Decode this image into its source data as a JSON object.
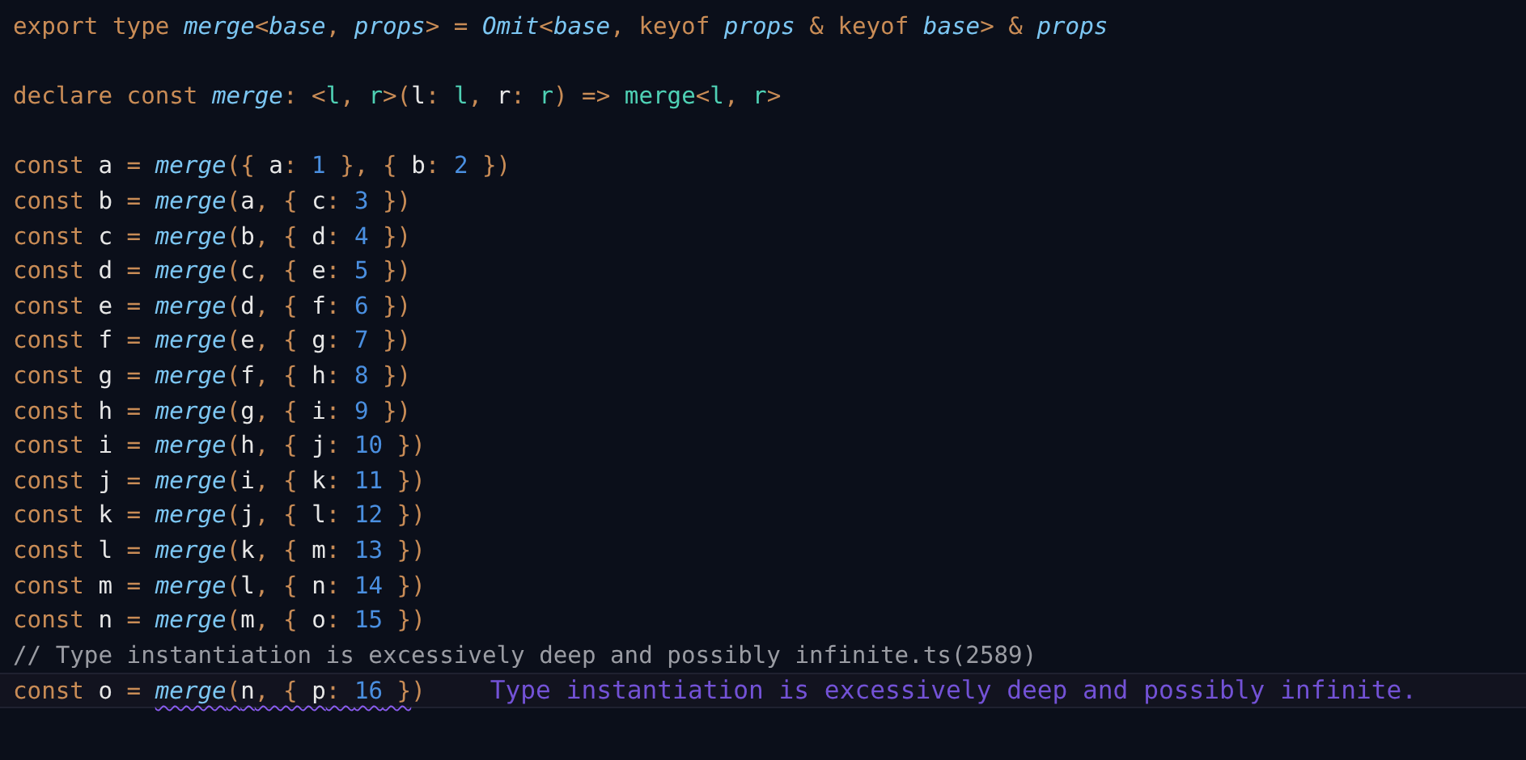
{
  "editor": {
    "lines": [
      {
        "kind": "code",
        "tokens": [
          {
            "text": "export type ",
            "kind": "keyword"
          },
          {
            "text": "merge",
            "kind": "type"
          },
          {
            "text": "<",
            "kind": "punct"
          },
          {
            "text": "base",
            "kind": "type"
          },
          {
            "text": ", ",
            "kind": "punct"
          },
          {
            "text": "props",
            "kind": "type"
          },
          {
            "text": "> = ",
            "kind": "punct"
          },
          {
            "text": "Omit",
            "kind": "type"
          },
          {
            "text": "<",
            "kind": "punct"
          },
          {
            "text": "base",
            "kind": "type"
          },
          {
            "text": ", ",
            "kind": "punct"
          },
          {
            "text": "keyof ",
            "kind": "keyword"
          },
          {
            "text": "props",
            "kind": "type"
          },
          {
            "text": " & ",
            "kind": "punct"
          },
          {
            "text": "keyof ",
            "kind": "keyword"
          },
          {
            "text": "base",
            "kind": "type"
          },
          {
            "text": "> & ",
            "kind": "punct"
          },
          {
            "text": "props",
            "kind": "type"
          }
        ]
      },
      {
        "kind": "blank"
      },
      {
        "kind": "code",
        "tokens": [
          {
            "text": "declare const ",
            "kind": "keyword"
          },
          {
            "text": "merge",
            "kind": "type"
          },
          {
            "text": ": <",
            "kind": "punct"
          },
          {
            "text": "l",
            "kind": "param"
          },
          {
            "text": ", ",
            "kind": "punct"
          },
          {
            "text": "r",
            "kind": "param"
          },
          {
            "text": ">(",
            "kind": "punct"
          },
          {
            "text": "l",
            "kind": "var"
          },
          {
            "text": ": ",
            "kind": "punct"
          },
          {
            "text": "l",
            "kind": "param"
          },
          {
            "text": ", ",
            "kind": "punct"
          },
          {
            "text": "r",
            "kind": "var"
          },
          {
            "text": ": ",
            "kind": "punct"
          },
          {
            "text": "r",
            "kind": "param"
          },
          {
            "text": ") => ",
            "kind": "punct"
          },
          {
            "text": "merge",
            "kind": "param"
          },
          {
            "text": "<",
            "kind": "punct"
          },
          {
            "text": "l",
            "kind": "param"
          },
          {
            "text": ", ",
            "kind": "punct"
          },
          {
            "text": "r",
            "kind": "param"
          },
          {
            "text": ">",
            "kind": "punct"
          }
        ]
      },
      {
        "kind": "blank"
      },
      {
        "kind": "code",
        "tokens": [
          {
            "text": "const ",
            "kind": "keyword"
          },
          {
            "text": "a",
            "kind": "var"
          },
          {
            "text": " = ",
            "kind": "punct"
          },
          {
            "text": "merge",
            "kind": "type"
          },
          {
            "text": "({ ",
            "kind": "punct"
          },
          {
            "text": "a",
            "kind": "var"
          },
          {
            "text": ": ",
            "kind": "punct"
          },
          {
            "text": "1",
            "kind": "number"
          },
          {
            "text": " }, { ",
            "kind": "punct"
          },
          {
            "text": "b",
            "kind": "var"
          },
          {
            "text": ": ",
            "kind": "punct"
          },
          {
            "text": "2",
            "kind": "number"
          },
          {
            "text": " })",
            "kind": "punct"
          }
        ]
      },
      {
        "kind": "code",
        "tokens": [
          {
            "text": "const ",
            "kind": "keyword"
          },
          {
            "text": "b",
            "kind": "var"
          },
          {
            "text": " = ",
            "kind": "punct"
          },
          {
            "text": "merge",
            "kind": "type"
          },
          {
            "text": "(",
            "kind": "punct"
          },
          {
            "text": "a",
            "kind": "var"
          },
          {
            "text": ", { ",
            "kind": "punct"
          },
          {
            "text": "c",
            "kind": "var"
          },
          {
            "text": ": ",
            "kind": "punct"
          },
          {
            "text": "3",
            "kind": "number"
          },
          {
            "text": " })",
            "kind": "punct"
          }
        ]
      },
      {
        "kind": "code",
        "tokens": [
          {
            "text": "const ",
            "kind": "keyword"
          },
          {
            "text": "c",
            "kind": "var"
          },
          {
            "text": " = ",
            "kind": "punct"
          },
          {
            "text": "merge",
            "kind": "type"
          },
          {
            "text": "(",
            "kind": "punct"
          },
          {
            "text": "b",
            "kind": "var"
          },
          {
            "text": ", { ",
            "kind": "punct"
          },
          {
            "text": "d",
            "kind": "var"
          },
          {
            "text": ": ",
            "kind": "punct"
          },
          {
            "text": "4",
            "kind": "number"
          },
          {
            "text": " })",
            "kind": "punct"
          }
        ]
      },
      {
        "kind": "code",
        "tokens": [
          {
            "text": "const ",
            "kind": "keyword"
          },
          {
            "text": "d",
            "kind": "var"
          },
          {
            "text": " = ",
            "kind": "punct"
          },
          {
            "text": "merge",
            "kind": "type"
          },
          {
            "text": "(",
            "kind": "punct"
          },
          {
            "text": "c",
            "kind": "var"
          },
          {
            "text": ", { ",
            "kind": "punct"
          },
          {
            "text": "e",
            "kind": "var"
          },
          {
            "text": ": ",
            "kind": "punct"
          },
          {
            "text": "5",
            "kind": "number"
          },
          {
            "text": " })",
            "kind": "punct"
          }
        ]
      },
      {
        "kind": "code",
        "tokens": [
          {
            "text": "const ",
            "kind": "keyword"
          },
          {
            "text": "e",
            "kind": "var"
          },
          {
            "text": " = ",
            "kind": "punct"
          },
          {
            "text": "merge",
            "kind": "type"
          },
          {
            "text": "(",
            "kind": "punct"
          },
          {
            "text": "d",
            "kind": "var"
          },
          {
            "text": ", { ",
            "kind": "punct"
          },
          {
            "text": "f",
            "kind": "var"
          },
          {
            "text": ": ",
            "kind": "punct"
          },
          {
            "text": "6",
            "kind": "number"
          },
          {
            "text": " })",
            "kind": "punct"
          }
        ]
      },
      {
        "kind": "code",
        "tokens": [
          {
            "text": "const ",
            "kind": "keyword"
          },
          {
            "text": "f",
            "kind": "var"
          },
          {
            "text": " = ",
            "kind": "punct"
          },
          {
            "text": "merge",
            "kind": "type"
          },
          {
            "text": "(",
            "kind": "punct"
          },
          {
            "text": "e",
            "kind": "var"
          },
          {
            "text": ", { ",
            "kind": "punct"
          },
          {
            "text": "g",
            "kind": "var"
          },
          {
            "text": ": ",
            "kind": "punct"
          },
          {
            "text": "7",
            "kind": "number"
          },
          {
            "text": " })",
            "kind": "punct"
          }
        ]
      },
      {
        "kind": "code",
        "tokens": [
          {
            "text": "const ",
            "kind": "keyword"
          },
          {
            "text": "g",
            "kind": "var"
          },
          {
            "text": " = ",
            "kind": "punct"
          },
          {
            "text": "merge",
            "kind": "type"
          },
          {
            "text": "(",
            "kind": "punct"
          },
          {
            "text": "f",
            "kind": "var"
          },
          {
            "text": ", { ",
            "kind": "punct"
          },
          {
            "text": "h",
            "kind": "var"
          },
          {
            "text": ": ",
            "kind": "punct"
          },
          {
            "text": "8",
            "kind": "number"
          },
          {
            "text": " })",
            "kind": "punct"
          }
        ]
      },
      {
        "kind": "code",
        "tokens": [
          {
            "text": "const ",
            "kind": "keyword"
          },
          {
            "text": "h",
            "kind": "var"
          },
          {
            "text": " = ",
            "kind": "punct"
          },
          {
            "text": "merge",
            "kind": "type"
          },
          {
            "text": "(",
            "kind": "punct"
          },
          {
            "text": "g",
            "kind": "var"
          },
          {
            "text": ", { ",
            "kind": "punct"
          },
          {
            "text": "i",
            "kind": "var"
          },
          {
            "text": ": ",
            "kind": "punct"
          },
          {
            "text": "9",
            "kind": "number"
          },
          {
            "text": " })",
            "kind": "punct"
          }
        ]
      },
      {
        "kind": "code",
        "tokens": [
          {
            "text": "const ",
            "kind": "keyword"
          },
          {
            "text": "i",
            "kind": "var"
          },
          {
            "text": " = ",
            "kind": "punct"
          },
          {
            "text": "merge",
            "kind": "type"
          },
          {
            "text": "(",
            "kind": "punct"
          },
          {
            "text": "h",
            "kind": "var"
          },
          {
            "text": ", { ",
            "kind": "punct"
          },
          {
            "text": "j",
            "kind": "var"
          },
          {
            "text": ": ",
            "kind": "punct"
          },
          {
            "text": "10",
            "kind": "number"
          },
          {
            "text": " })",
            "kind": "punct"
          }
        ]
      },
      {
        "kind": "code",
        "tokens": [
          {
            "text": "const ",
            "kind": "keyword"
          },
          {
            "text": "j",
            "kind": "var"
          },
          {
            "text": " = ",
            "kind": "punct"
          },
          {
            "text": "merge",
            "kind": "type"
          },
          {
            "text": "(",
            "kind": "punct"
          },
          {
            "text": "i",
            "kind": "var"
          },
          {
            "text": ", { ",
            "kind": "punct"
          },
          {
            "text": "k",
            "kind": "var"
          },
          {
            "text": ": ",
            "kind": "punct"
          },
          {
            "text": "11",
            "kind": "number"
          },
          {
            "text": " })",
            "kind": "punct"
          }
        ]
      },
      {
        "kind": "code",
        "tokens": [
          {
            "text": "const ",
            "kind": "keyword"
          },
          {
            "text": "k",
            "kind": "var"
          },
          {
            "text": " = ",
            "kind": "punct"
          },
          {
            "text": "merge",
            "kind": "type"
          },
          {
            "text": "(",
            "kind": "punct"
          },
          {
            "text": "j",
            "kind": "var"
          },
          {
            "text": ", { ",
            "kind": "punct"
          },
          {
            "text": "l",
            "kind": "var"
          },
          {
            "text": ": ",
            "kind": "punct"
          },
          {
            "text": "12",
            "kind": "number"
          },
          {
            "text": " })",
            "kind": "punct"
          }
        ]
      },
      {
        "kind": "code",
        "tokens": [
          {
            "text": "const ",
            "kind": "keyword"
          },
          {
            "text": "l",
            "kind": "var"
          },
          {
            "text": " = ",
            "kind": "punct"
          },
          {
            "text": "merge",
            "kind": "type"
          },
          {
            "text": "(",
            "kind": "punct"
          },
          {
            "text": "k",
            "kind": "var"
          },
          {
            "text": ", { ",
            "kind": "punct"
          },
          {
            "text": "m",
            "kind": "var"
          },
          {
            "text": ": ",
            "kind": "punct"
          },
          {
            "text": "13",
            "kind": "number"
          },
          {
            "text": " })",
            "kind": "punct"
          }
        ]
      },
      {
        "kind": "code",
        "tokens": [
          {
            "text": "const ",
            "kind": "keyword"
          },
          {
            "text": "m",
            "kind": "var"
          },
          {
            "text": " = ",
            "kind": "punct"
          },
          {
            "text": "merge",
            "kind": "type"
          },
          {
            "text": "(",
            "kind": "punct"
          },
          {
            "text": "l",
            "kind": "var"
          },
          {
            "text": ", { ",
            "kind": "punct"
          },
          {
            "text": "n",
            "kind": "var"
          },
          {
            "text": ": ",
            "kind": "punct"
          },
          {
            "text": "14",
            "kind": "number"
          },
          {
            "text": " })",
            "kind": "punct"
          }
        ]
      },
      {
        "kind": "code",
        "tokens": [
          {
            "text": "const ",
            "kind": "keyword"
          },
          {
            "text": "n",
            "kind": "var"
          },
          {
            "text": " = ",
            "kind": "punct"
          },
          {
            "text": "merge",
            "kind": "type"
          },
          {
            "text": "(",
            "kind": "punct"
          },
          {
            "text": "m",
            "kind": "var"
          },
          {
            "text": ", { ",
            "kind": "punct"
          },
          {
            "text": "o",
            "kind": "var"
          },
          {
            "text": ": ",
            "kind": "punct"
          },
          {
            "text": "15",
            "kind": "number"
          },
          {
            "text": " })",
            "kind": "punct"
          }
        ]
      },
      {
        "kind": "code",
        "tokens": [
          {
            "text": "// Type instantiation is excessively deep and possibly infinite.ts(2589)",
            "kind": "comment"
          }
        ]
      },
      {
        "kind": "code",
        "current": true,
        "hint": "Type instantiation is excessively deep and possibly infinite.",
        "tokens": [
          {
            "text": "const ",
            "kind": "keyword"
          },
          {
            "text": "o",
            "kind": "var"
          },
          {
            "text": " = ",
            "kind": "punct"
          },
          {
            "text": "merge",
            "kind": "type",
            "error": true
          },
          {
            "text": "(",
            "kind": "punct",
            "error": true
          },
          {
            "text": "n",
            "kind": "var",
            "error": true
          },
          {
            "text": ", { ",
            "kind": "punct",
            "error": true
          },
          {
            "text": "p",
            "kind": "var",
            "error": true
          },
          {
            "text": ": ",
            "kind": "punct",
            "error": true
          },
          {
            "text": "16",
            "kind": "number",
            "error": true
          },
          {
            "text": " }",
            "kind": "punct",
            "error": true
          },
          {
            "text": ")",
            "kind": "punct"
          }
        ]
      }
    ]
  }
}
